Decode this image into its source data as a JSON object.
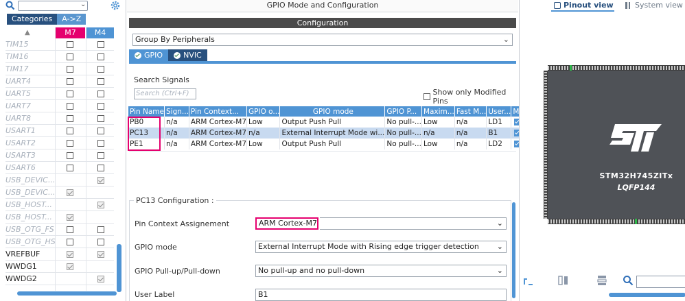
{
  "left_panel": {
    "search": {
      "value": "",
      "placeholder": ""
    },
    "tabs": [
      {
        "label": "Categories",
        "active": false
      },
      {
        "label": "A->Z",
        "active": true
      }
    ],
    "columns": {
      "m7": "M7",
      "m4": "M4"
    },
    "rows": [
      {
        "name": "TIM15",
        "enabled": false,
        "m7": "unchecked",
        "m4": "unchecked"
      },
      {
        "name": "TIM16",
        "enabled": false,
        "m7": "unchecked",
        "m4": "unchecked"
      },
      {
        "name": "TIM17",
        "enabled": false,
        "m7": "unchecked",
        "m4": "unchecked"
      },
      {
        "name": "UART4",
        "enabled": false,
        "m7": "unchecked",
        "m4": "unchecked"
      },
      {
        "name": "UART5",
        "enabled": false,
        "m7": "unchecked",
        "m4": "unchecked"
      },
      {
        "name": "UART7",
        "enabled": false,
        "m7": "unchecked",
        "m4": "unchecked"
      },
      {
        "name": "UART8",
        "enabled": false,
        "m7": "unchecked",
        "m4": "unchecked"
      },
      {
        "name": "USART1",
        "enabled": false,
        "m7": "unchecked",
        "m4": "unchecked"
      },
      {
        "name": "USART2",
        "enabled": false,
        "m7": "unchecked",
        "m4": "unchecked"
      },
      {
        "name": "USART3",
        "enabled": false,
        "m7": "unchecked",
        "m4": "unchecked"
      },
      {
        "name": "USART6",
        "enabled": false,
        "m7": "unchecked",
        "m4": "unchecked"
      },
      {
        "name": "USB_DEVIC...",
        "enabled": false,
        "m7": "none",
        "m4": "checked"
      },
      {
        "name": "USB_DEVIC...",
        "enabled": false,
        "m7": "checked",
        "m4": "none"
      },
      {
        "name": "USB_HOST...",
        "enabled": false,
        "m7": "none",
        "m4": "checked"
      },
      {
        "name": "USB_HOST...",
        "enabled": false,
        "m7": "checked",
        "m4": "none"
      },
      {
        "name": "USB_OTG_FS",
        "enabled": false,
        "m7": "unchecked",
        "m4": "unchecked"
      },
      {
        "name": "USB_OTG_HS",
        "enabled": false,
        "m7": "unchecked",
        "m4": "unchecked"
      },
      {
        "name": "VREFBUF",
        "enabled": true,
        "m7": "checked",
        "m4": "checked"
      },
      {
        "name": "WWDG1",
        "enabled": true,
        "m7": "checked",
        "m4": "none"
      },
      {
        "name": "WWDG2",
        "enabled": true,
        "m7": "none",
        "m4": "checked"
      }
    ]
  },
  "center_panel": {
    "title": "GPIO Mode and Configuration",
    "configuration_label": "Configuration",
    "group_by": "Group By Peripherals",
    "tabs": [
      {
        "label": "GPIO",
        "active": true
      },
      {
        "label": "NVIC",
        "active": false
      }
    ],
    "search_signals_label": "Search Signals",
    "search_placeholder": "Search (Ctrl+F)",
    "show_only_modified": "Show only Modified Pins",
    "table": {
      "headers": [
        "Pin Name",
        "Sign...",
        "Pin Context...",
        "GPIO o...",
        "GPIO mode",
        "GPIO P...",
        "Maxim...",
        "Fast M...",
        "User...",
        "Modi..."
      ],
      "rows": [
        {
          "cells": [
            "PB0",
            "n/a",
            "ARM Cortex-M7",
            "Low",
            "Output Push Pull",
            "No pull-...",
            "Low",
            "n/a",
            "LD1"
          ],
          "modified": true,
          "selected": false
        },
        {
          "cells": [
            "PC13",
            "n/a",
            "ARM Cortex-M7",
            "n/a",
            "External Interrupt Mode wi...",
            "No pull-...",
            "n/a",
            "n/a",
            "B1"
          ],
          "modified": true,
          "selected": true
        },
        {
          "cells": [
            "PE1",
            "n/a",
            "ARM Cortex-M7",
            "Low",
            "Output Push Pull",
            "No pull-...",
            "Low",
            "n/a",
            "LD2"
          ],
          "modified": true,
          "selected": false
        }
      ]
    },
    "pc13_config": {
      "legend": "PC13 Configuration :",
      "rows": [
        {
          "label": "Pin Context Assignement",
          "value": "ARM Cortex-M7"
        },
        {
          "label": "GPIO mode",
          "value": "External Interrupt Mode with Rising edge trigger detection"
        },
        {
          "label": "GPIO Pull-up/Pull-down",
          "value": "No pull-up and no pull-down"
        },
        {
          "label": "User Label",
          "value": "B1"
        }
      ]
    }
  },
  "right_panel": {
    "pinout_view": "Pinout view",
    "system_view": "System view",
    "chip_name": "STM32H745ZITx",
    "package": "LQFP144",
    "zoom_search": {
      "value": ""
    }
  },
  "colors": {
    "accent_blue": "#4f94d4",
    "dark_blue": "#28507e",
    "highlight_magenta": "#e5006e",
    "chip_body": "#4f5257"
  }
}
